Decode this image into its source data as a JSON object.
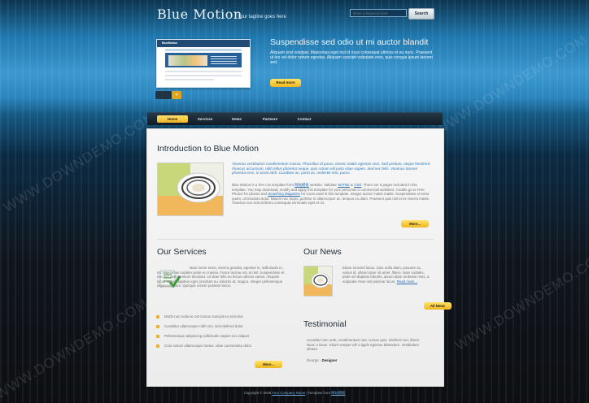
{
  "header": {
    "logo": "Blue Motion",
    "tagline": "Your tagline goes here",
    "search_placeholder": "Enter a keyword here",
    "search_button": "Search"
  },
  "hero": {
    "title": "Suspendisse sed odio ut mi auctor blandit",
    "text": "Aliquam erat volutpat. Maecenas eget nisl id risus consequat ultrices et eu nunc. Praesent ut leo vel dolor rutrum egestas. Aliquam suscipit vulputate eros, quis congue ipsum laoreet sed.",
    "read_more": "Read more",
    "slider_next": "»",
    "thumb_logo": "BlueMotion"
  },
  "nav": {
    "items": [
      "Home",
      "Services",
      "News",
      "Partners",
      "Contact"
    ]
  },
  "intro": {
    "title": "Introduction to Blue Motion",
    "lead": "Vivamus vestibulum condimentum massa. Phasellus id purus. Donec mattis egestas sem. Sed pretium, neque hendrerit rhoncus accumsan, nibh tellus pharetra neque, quis rutrum elit justo vitae sapien. Sed nec felis. Vivamus laoreet pharetra eros, in porta nibh. Curabitur ac, porta ac, molestie non, purus.",
    "body_1": "Blue Motion is a free css template from",
    "body_link": "网站模板",
    "body_2": "website. Validate",
    "xhtml": "XHTML",
    "and": "&",
    "css": "CSS",
    "body_3": ". There are 5 pages included in this template. You may download, modify and apply this template for your personal or commercial websites. Credits go to Free Photos for photos and",
    "smashing": "Smashing Magazine",
    "body_4": "for icons used in this template. Integer auctor mattis mattis. Suspendisse et tortor quam, ut tincidunt dolor. Mauris nec turpis, porttitor in ullamcorper ac, tempus eu diam. Praesent quis nisl id mi viverra mattis. Vivamus non erat at libero consequat venenatis eget et mi.",
    "more": "More..."
  },
  "services": {
    "title": "Our Services",
    "text": "Nam lorem tortor, viverra gravida, egestas in, sollicitudin in, mi. Maecenas sodales pede eu massa. Fusce lacinia orci at nisl. Suspendisse et nisi nec diam pretium tincidunt. Ut vitae felis eu lectus ultrices varius. Aliquam lacus turpis, dapibus eget, tincidunt eu, lobortis at, magna. Integer pellentesque dignissim diam. Quisque ornare pulvinar lacus.",
    "bullets": [
      "Morbi non nulla ac est cursus suscipit eu at lectus",
      "Curabitur ullamcorper nibh nisi, sed eleifend dolor",
      "Pellentesque adipiscing sollicitudin sapien nec aliquet",
      "Cras rutrum ullamcorper metus, vitae consectetur dolor"
    ],
    "more": "More..."
  },
  "news": {
    "title": "Our News",
    "text": "Etiam sit amet lacus. Duis nulla diam, posuere ac, varius id, ullamcorper sit amet, libero. Nam sodales, pede vel dapibus lobortis, ipsum diam molestie risus, a vulputate risus nisl pulvinar lacus.",
    "read_more": "Read more...",
    "all_news": "All News"
  },
  "testimonial": {
    "title": "Testimonial",
    "text": "Curabitur non ante, condimentum non, cursus quis, eleifend non, libero. Nunc a lacus. Etiam semper elit a ligula egestas bibendum. Vestibulum dictum.",
    "author_prefix": "George -",
    "author_role": "Designer"
  },
  "footer": {
    "prefix": "Copyright © 2048",
    "company": "Your Company Name",
    "middle": "| Template from",
    "source": "网站模板"
  },
  "watermark": "WWW.DOWNDEMO.COM"
}
